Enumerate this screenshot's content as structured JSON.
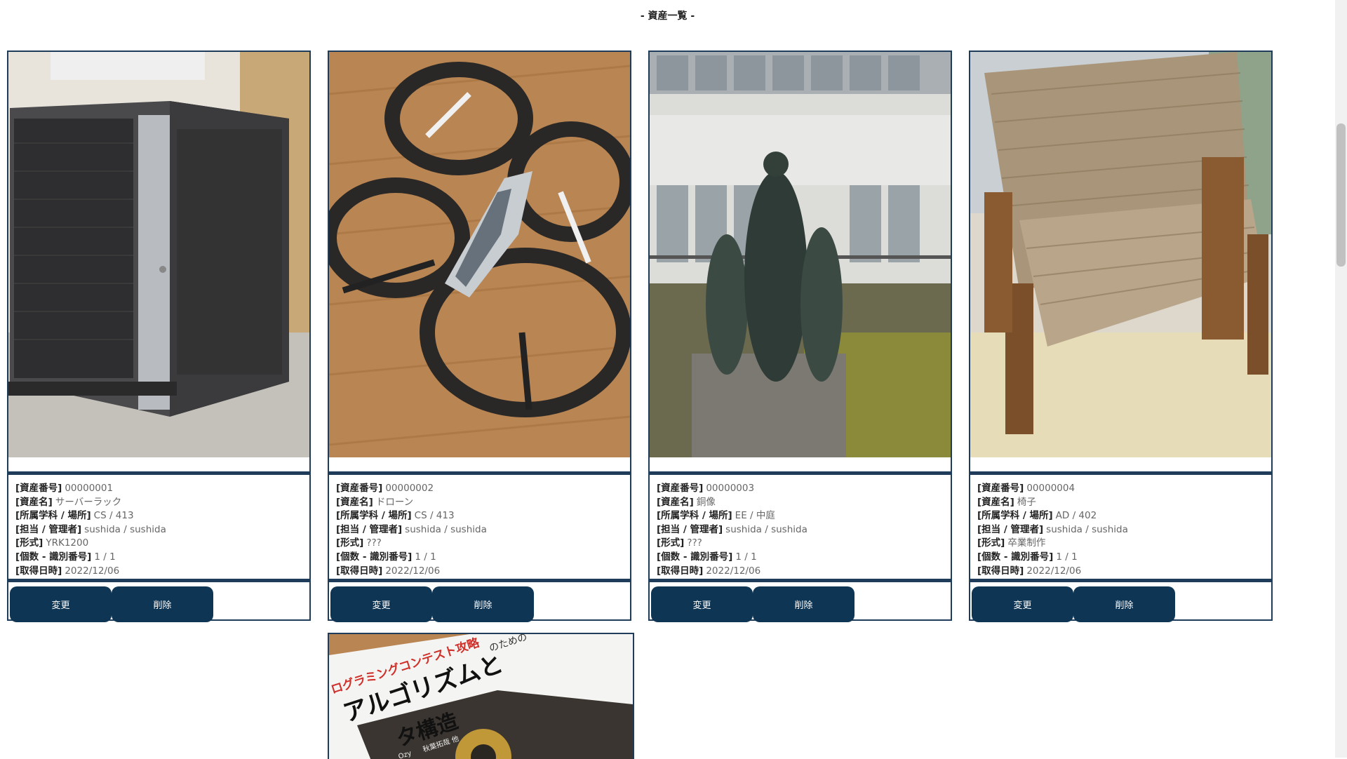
{
  "page_title": "- 資産一覧 -",
  "labels": {
    "asset_no": "[資産番号]",
    "asset_name": "[資産名]",
    "location": "[所属学科 / 場所]",
    "manager": "[担当 / 管理者]",
    "type": "[形式]",
    "count": "[個数 - 識別番号]",
    "acquired": "[取得日時]"
  },
  "buttons": {
    "edit": "変更",
    "delete": "削除"
  },
  "assets": [
    {
      "asset_no": "00000001",
      "asset_name": "サーバーラック",
      "location": "CS / 413",
      "manager": "sushida / sushida",
      "type": "YRK1200",
      "count": "1 / 1",
      "acquired": "2022/12/06",
      "photo": "server-rack-photo"
    },
    {
      "asset_no": "00000002",
      "asset_name": "ドローン",
      "location": "CS / 413",
      "manager": "sushida / sushida",
      "type": "???",
      "count": "1 / 1",
      "acquired": "2022/12/06",
      "photo": "drone-photo"
    },
    {
      "asset_no": "00000003",
      "asset_name": "銅像",
      "location": "EE / 中庭",
      "manager": "sushida / sushida",
      "type": "???",
      "count": "1 / 1",
      "acquired": "2022/12/06",
      "photo": "statue-photo"
    },
    {
      "asset_no": "00000004",
      "asset_name": "椅子",
      "location": "AD / 402",
      "manager": "sushida / sushida",
      "type": "卒業制作",
      "count": "1 / 1",
      "acquired": "2022/12/06",
      "photo": "chair-photo"
    }
  ],
  "partial_card": {
    "photo": "book-photo",
    "cover_red_text": "ログラミングコンテスト攻略",
    "cover_red_suffix": "のための",
    "cover_title_1": "アルゴリズムと",
    "cover_title_2": "タ構造",
    "cover_authors": "秋葉拓哉 他",
    "cover_authors_prefix": "Ozy"
  }
}
